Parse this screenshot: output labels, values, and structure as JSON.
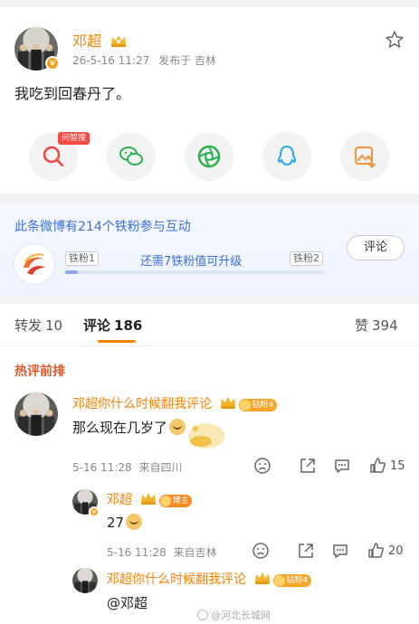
{
  "post": {
    "author": "邓超",
    "time": "26-5-16 11:27",
    "source": "发布于 吉林",
    "text": "我吃到回春丹了。"
  },
  "share": {
    "tag": "问智搜",
    "icons": [
      "search-ai-icon",
      "wechat-icon",
      "moments-icon",
      "qq-icon",
      "save-image-icon"
    ]
  },
  "fan": {
    "title": "此条微博有214个铁粉参与互动",
    "level_current": "铁粉1",
    "level_next": "铁粉2",
    "need_text": "还需7铁粉值可升级",
    "progress_fraction": 0.05,
    "comment_button": "评论"
  },
  "tabs": {
    "repost_label": "转发",
    "repost_count": "10",
    "comment_label": "评论",
    "comment_count": "186",
    "like_label": "赞",
    "like_count": "394"
  },
  "hot_title": "热评前排",
  "comments": [
    {
      "name": "邓超你什么时候翻我评论",
      "badge": "钻粉4",
      "text": "那么现在几岁了",
      "time": "5-16 11:28",
      "location": "来自四川",
      "likes": "15"
    },
    {
      "name": "邓超",
      "badge": "博主",
      "text": "27",
      "time": "5-16 11:28",
      "location": "来自吉林",
      "likes": "20"
    },
    {
      "name": "邓超你什么时候翻我评论",
      "badge": "钻粉4",
      "text": "@邓超"
    }
  ],
  "watermark": "@河北长城网",
  "colors": {
    "accent": "#ff8200",
    "link": "#3d6fd6",
    "hot": "#e3572a"
  }
}
